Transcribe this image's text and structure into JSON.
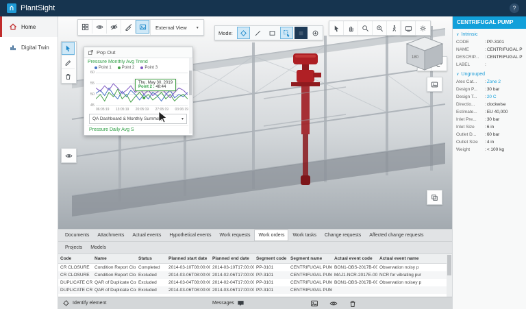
{
  "app": {
    "title": "PlantSight",
    "help_label": "?"
  },
  "sidebar": {
    "items": [
      {
        "label": "Home"
      },
      {
        "label": "Digital Twin"
      }
    ]
  },
  "viewer_toolbar": {
    "external_view": "External View",
    "mode_label": "Mode:"
  },
  "popup": {
    "header": "Pop Out",
    "dropdown": "QA Dashboard & Monthly Summary",
    "next_chart_title": "Pressure Daily Avg S",
    "tooltip": {
      "date": "Thu, May 30, 2019",
      "series": "Point 2 :",
      "value": "48:44"
    }
  },
  "chart_data": {
    "type": "line",
    "title": "Pressure Monthly Avg Trend",
    "x_labels": [
      "06:05:19",
      "13:05:19",
      "20:05:19",
      "27:05:19",
      "03:06:19"
    ],
    "y_ticks": [
      60,
      55,
      50,
      45
    ],
    "ylim": [
      44,
      61
    ],
    "grid": true,
    "legend_position": "top",
    "series": [
      {
        "name": "Point 1",
        "color": "#4472c4",
        "values": [
          50.5,
          52,
          49.5,
          53,
          50,
          48,
          51.5,
          49,
          52,
          50,
          47.5,
          50,
          48,
          51,
          49.5,
          47,
          50,
          52,
          48.5,
          50,
          49,
          51
        ]
      },
      {
        "name": "Point 2",
        "color": "#43a047",
        "values": [
          48,
          50,
          47,
          51,
          49,
          52.5,
          48,
          50,
          46.5,
          49,
          51,
          48.44,
          50,
          47.5,
          49,
          51,
          48,
          50,
          47,
          49,
          50,
          48
        ]
      },
      {
        "name": "Point 3",
        "color": "#7e57c2",
        "values": [
          53,
          51.5,
          54,
          52,
          55,
          53,
          50.5,
          52,
          54,
          51,
          53,
          50,
          52,
          49.5,
          51,
          53,
          50.5,
          48.5,
          51,
          53,
          52,
          50
        ]
      }
    ]
  },
  "properties": {
    "title": "CENTRIFUGAL PUMP",
    "groups": [
      {
        "name": "Intrinsic",
        "fields": [
          {
            "label": "CODE",
            "value": "PP-3101"
          },
          {
            "label": "NAME",
            "value": "CENTRIFUGAL PUMP"
          },
          {
            "label": "DESCRIP...",
            "value": "CENTRIFUGAL PUMP"
          },
          {
            "label": "LABEL",
            "value": ""
          }
        ]
      },
      {
        "name": "Ungrouped",
        "fields": [
          {
            "label": "Atex Cat...",
            "value": "Zone 2",
            "highlight": true
          },
          {
            "label": "Design P...",
            "value": "30 bar"
          },
          {
            "label": "Design T...",
            "value": "20 C",
            "highlight": true
          },
          {
            "label": "Directio...",
            "value": "clockwise"
          },
          {
            "label": "Estimate...",
            "value": "EU 40,000"
          },
          {
            "label": "Inlet Pre...",
            "value": "30 bar"
          },
          {
            "label": "Inlet Size",
            "value": "6 in"
          },
          {
            "label": "Outlet D...",
            "value": "60 bar"
          },
          {
            "label": "Outlet Size",
            "value": "4 in"
          },
          {
            "label": "Weight",
            "value": "< 100 kg"
          }
        ]
      }
    ]
  },
  "tabs": {
    "row1": [
      "Documents",
      "Attachments",
      "Actual events",
      "Hypothetical events",
      "Work requests",
      "Work orders",
      "Work tasks",
      "Change requests",
      "Affected change requests"
    ],
    "active1": 5,
    "row2": [
      "Projects",
      "Models"
    ]
  },
  "table": {
    "columns": [
      "Code",
      "Name",
      "Status",
      "Planned start date",
      "Planned end date",
      "Segment code",
      "Segment name",
      "Actual event code",
      "Actual event name"
    ],
    "rows": [
      [
        "CR CLOSURE",
        "Condition Report Clo",
        "Completed",
        "2014-03-10T08:00:00",
        "2014-03-10T17:00:00",
        "PP-3101",
        "CENTRIFUGAL PUMP",
        "BON1-OBS-2017B-00",
        "Observation noisy p"
      ],
      [
        "CR CLOSURE",
        "Condition Report Clo",
        "Excluded",
        "2014-03-06T08:00:00",
        "2014-02-06T17:00:00",
        "PP-3101",
        "CENTRIFUGAL PUMP",
        "MAJ1-NCR-2017E-00X",
        "NCR for vibrating pur"
      ],
      [
        "DUPLICATE CR",
        "QAR of Duplicate Cor",
        "Excluded",
        "2014-03-04T08:00:00",
        "2014-02-04T17:00:00",
        "PP-3101",
        "CENTRIFUGAL PUMP",
        "BON1-OBS-2017B-00",
        "Observation noisey p"
      ],
      [
        "DUPLICATE CR",
        "QAR of Duplicate Con",
        "Excluded",
        "2014-03-06T08:00:00",
        "2014-03-06T17:00:00",
        "PP-3101",
        "CENTRIFUGAL PUMP",
        "",
        ""
      ]
    ]
  },
  "statusbar": {
    "identify": "Identify element",
    "messages": "Messages"
  },
  "colors": {
    "accent": "#12a0da",
    "active_red": "#c02b2b",
    "pump_red": "#b02025",
    "chart_green": "#2e9e44"
  }
}
